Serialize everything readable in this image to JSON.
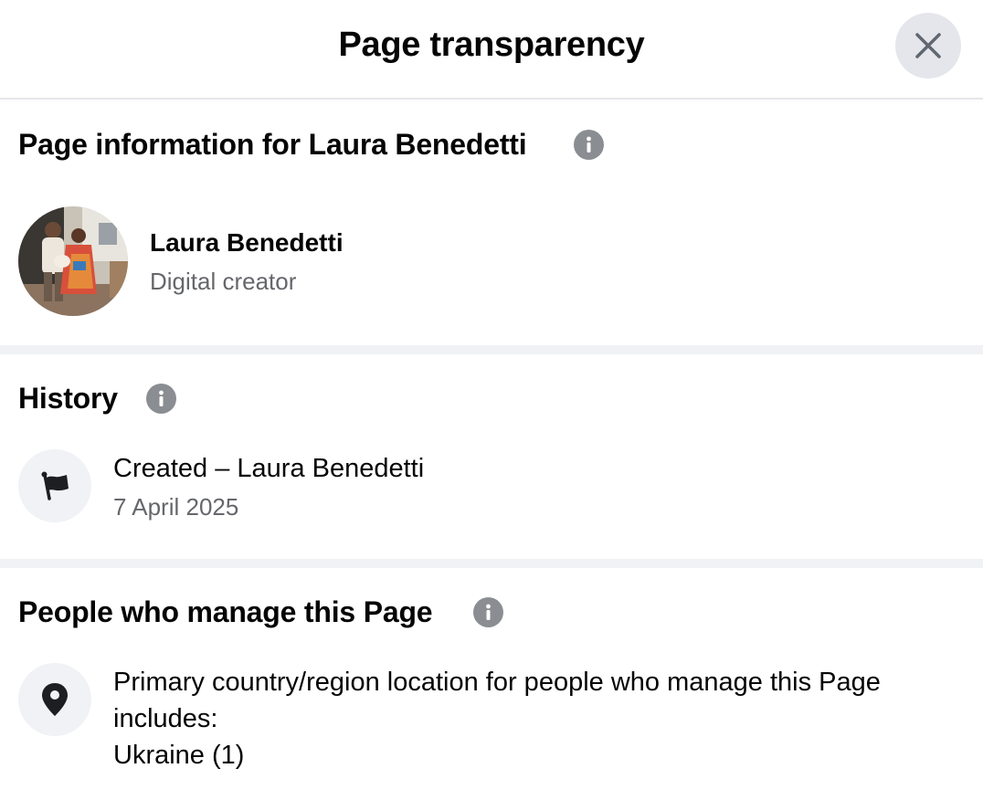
{
  "header": {
    "title": "Page transparency"
  },
  "page_info": {
    "title": "Page information for Laura Benedetti",
    "name": "Laura Benedetti",
    "category": "Digital creator"
  },
  "history": {
    "title": "History",
    "event": "Created – Laura Benedetti",
    "date": "7 April 2025"
  },
  "managers": {
    "title": "People who manage this Page",
    "line1": "Primary country/region location for people who manage this Page",
    "line2": "includes:",
    "line3": "Ukraine (1)"
  },
  "icons": {
    "close": "close-icon",
    "info": "info-icon",
    "flag": "flag-icon",
    "location": "location-pin-icon"
  },
  "colors": {
    "divider": "#f0f2f5",
    "secondary_text": "#65676b",
    "info_icon": "#8a8d91"
  }
}
